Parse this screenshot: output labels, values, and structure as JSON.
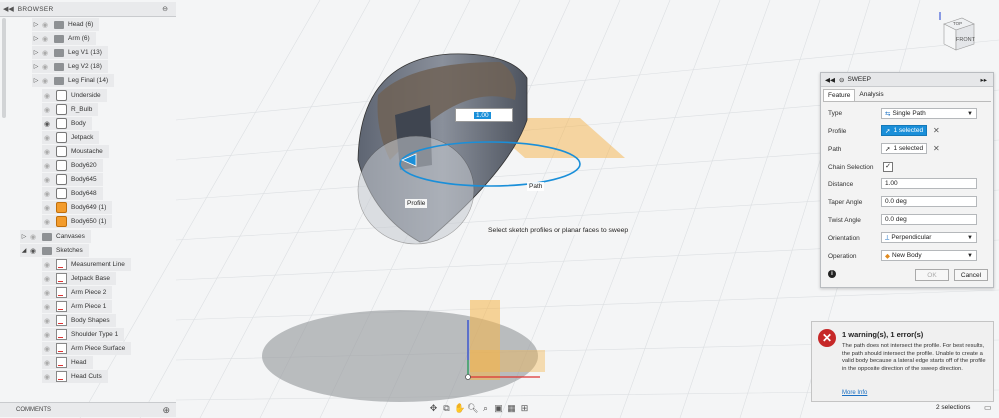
{
  "browser": {
    "title": "BROWSER",
    "items": [
      {
        "label": "Head (6)",
        "type": "folder"
      },
      {
        "label": "Arm (6)",
        "type": "folder"
      },
      {
        "label": "Leg V1 (13)",
        "type": "folder"
      },
      {
        "label": "Leg V2 (18)",
        "type": "folder"
      },
      {
        "label": "Leg Final (14)",
        "type": "folder"
      },
      {
        "label": "Underside",
        "type": "body"
      },
      {
        "label": "R_Bulb",
        "type": "body"
      },
      {
        "label": "Body",
        "type": "body"
      },
      {
        "label": "Jetpack",
        "type": "body"
      },
      {
        "label": "Moustache",
        "type": "body"
      },
      {
        "label": "Body620",
        "type": "body"
      },
      {
        "label": "Body645",
        "type": "body"
      },
      {
        "label": "Body648",
        "type": "body"
      },
      {
        "label": "Body649 (1)",
        "type": "component"
      },
      {
        "label": "Body650 (1)",
        "type": "component"
      }
    ],
    "canvases": "Canvases",
    "sketches": "Sketches",
    "sketch_items": [
      "Measurement Line",
      "Jetpack Base",
      "Arm Piece 2",
      "Arm Piece 1",
      "Body Shapes",
      "Shoulder Type 1",
      "Arm Piece Surface",
      "Head",
      "Head Cuts"
    ]
  },
  "comments": {
    "label": "COMMENTS"
  },
  "viewcube": {
    "front": "FRONT",
    "top": "TOP"
  },
  "viewport": {
    "value_input": "1.00",
    "path_label": "Path",
    "profile_label": "Profile",
    "tooltip": "Select sketch profiles or planar faces to sweep"
  },
  "sweep": {
    "title": "SWEEP",
    "tabs": [
      "Feature",
      "Analysis"
    ],
    "type_label": "Type",
    "type_value": "Single Path",
    "profile_label": "Profile",
    "profile_value": "1 selected",
    "path_label": "Path",
    "path_value": "1 selected",
    "chain_label": "Chain Selection",
    "distance_label": "Distance",
    "distance_value": "1.00",
    "taper_label": "Taper Angle",
    "taper_value": "0.0 deg",
    "twist_label": "Twist Angle",
    "twist_value": "0.0 deg",
    "orientation_label": "Orientation",
    "orientation_value": "Perpendicular",
    "operation_label": "Operation",
    "operation_value": "New Body",
    "ok": "OK",
    "cancel": "Cancel"
  },
  "notification": {
    "heading": "1 warning(s), 1 error(s)",
    "message": "The path does not intersect the profile. For best results, the path should intersect the profile. Unable to create a valid body because a lateral edge starts off of the profile in the opposite direction of the sweep direction.",
    "more": "More Info"
  },
  "status": {
    "selections": "2 selections"
  },
  "colors": {
    "accent": "#1a8fd9",
    "error": "#c62828",
    "sketch_plane": "#f5b449"
  }
}
